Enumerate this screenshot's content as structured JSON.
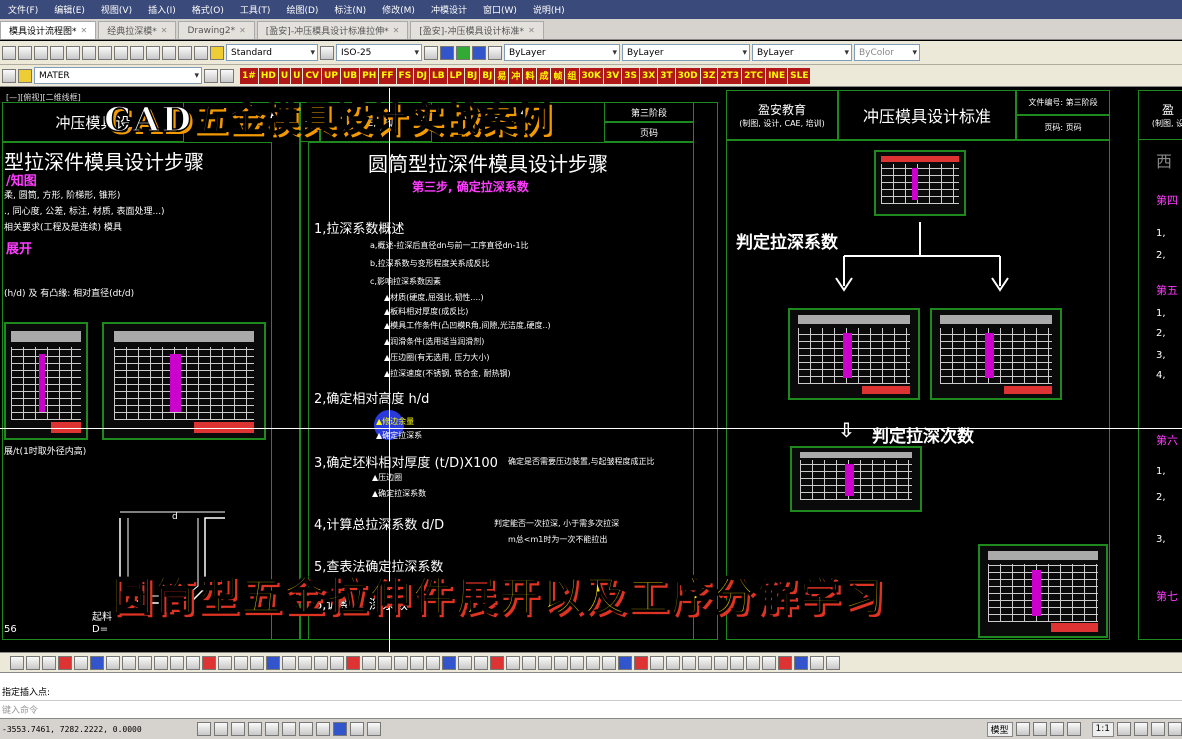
{
  "menu": [
    "文件(F)",
    "编辑(E)",
    "视图(V)",
    "插入(I)",
    "格式(O)",
    "工具(T)",
    "绘图(D)",
    "标注(N)",
    "修改(M)",
    "冲模设计",
    "窗口(W)",
    "说明(H)"
  ],
  "tabs": [
    {
      "label": "模具设计流程图*",
      "active": true
    },
    {
      "label": "经典拉深模*",
      "active": false
    },
    {
      "label": "Drawing2*",
      "active": false
    },
    {
      "label": "[盈安]-冲压模具设计标准拉伸*",
      "active": false
    },
    {
      "label": "[盈安]-冲压模具设计标准*",
      "active": false
    }
  ],
  "toolbar1": {
    "text_style": "Standard",
    "dim_style": "ISO-25",
    "layer_color": "ByLayer",
    "linetype": "ByLayer",
    "lineweight": "ByLayer",
    "plot_style": "ByColor"
  },
  "toolbar2": {
    "layer": "MATER",
    "plugin_buttons": [
      "1#",
      "HD",
      "U",
      "U",
      "CV",
      "UP",
      "UB",
      "PH",
      "FF",
      "FS",
      "DJ",
      "LB",
      "LP",
      "BJ",
      "BJ",
      "易",
      "冲",
      "料",
      "成",
      "帧",
      "组",
      "30K",
      "3V",
      "3S",
      "3X",
      "3T",
      "30D",
      "3Z",
      "2T3",
      "2TC",
      "INE",
      "SLE"
    ]
  },
  "canvas": {
    "view_label": "[—][俯视][二维线框]",
    "overlay_title": "CAD五金模具设计实战案例",
    "overlay_subtitle": "圆筒型五金拉伸件展开以及工序分解学习",
    "left": {
      "header": "冲压模具设",
      "heading": "型拉深件模具设计步骤",
      "sub": "/知图",
      "lines": [
        "柔, 圆筒, 方形, 阶梯形, 锥形)",
        "., 同心度, 公差, 标注, 材质, 表面处理...)",
        "相关要求(工程及是连续) 模具"
      ],
      "sub2": "展开",
      "formula": "(h/d) 及 有凸缘: 相对直径(dt/d)",
      "bottom": "展/t(1时取外径内高)",
      "dim_label": "d",
      "dims": [
        "起料",
        "D="
      ],
      "num": "56"
    },
    "middle": {
      "header_left": "大",
      "header_mid": "CAE, 培训",
      "header_right": "第三阶段",
      "page_label": "页码",
      "title": "圆筒型拉深件模具设计步骤",
      "step": "第三步, 确定拉深系数",
      "items": [
        "1,拉深系数概述",
        "2,确定相对高度  h/d",
        "3,确定坯料相对厚度 (t/D)X100",
        "4,计算总拉深系数  d/D",
        "5,查表法确定拉深系数",
        "6,调整... 深系数"
      ],
      "subitems": [
        "a,概述-拉深后直径dn与前一工序直径dn-1比",
        "b,拉深系数与变形程度关系成反比",
        "c,影响拉深系数因素",
        "▲材质(硬度,屈强比,韧性....)",
        "▲板料相对厚度(成反比)",
        "▲模具工作条件(凸凹模R角,间隙,光洁度,硬度..)",
        "▲润滑条件(选用适当润滑剂)",
        "▲压边圈(有无选用, 压力大小)",
        "▲拉深速度(不锈钢, 铁合金, 耐热钢)"
      ],
      "h2_items": [
        "▲修边余量",
        "▲确定拉深系"
      ],
      "h3_items": [
        "▲压边圈",
        "▲确定拉深系数"
      ],
      "arrow_note3": "确定是否需要压边装置,与起皱程度成正比",
      "arrow_note4a": "判定能否一次拉深, 小于需多次拉深",
      "arrow_note4b": "m总<m1时为一次不能拉出"
    },
    "right": {
      "org": "盈安教育",
      "org_sub": "(制图, 设计, CAE, 培训)",
      "title": "冲压模具设计标准",
      "doc_no": "文件编号: 第三阶段",
      "page": "页码: 页码",
      "label1": "判定拉深系数",
      "label2": "判定拉深次数"
    },
    "far_right": {
      "org": "盈",
      "org_sub": "(制图, 设",
      "items": [
        "西",
        "第四",
        "1,",
        "2,",
        "第五",
        "1,",
        "2,",
        "3,",
        "4,",
        "第六",
        "1,",
        "2,",
        "3,",
        "第七"
      ]
    }
  },
  "command": {
    "line1": "指定插入点:",
    "placeholder": "键入命令"
  },
  "status": {
    "coords": "-3553.7461, 7282.2222, 0.0000",
    "model": "模型",
    "scale": "1:1"
  }
}
